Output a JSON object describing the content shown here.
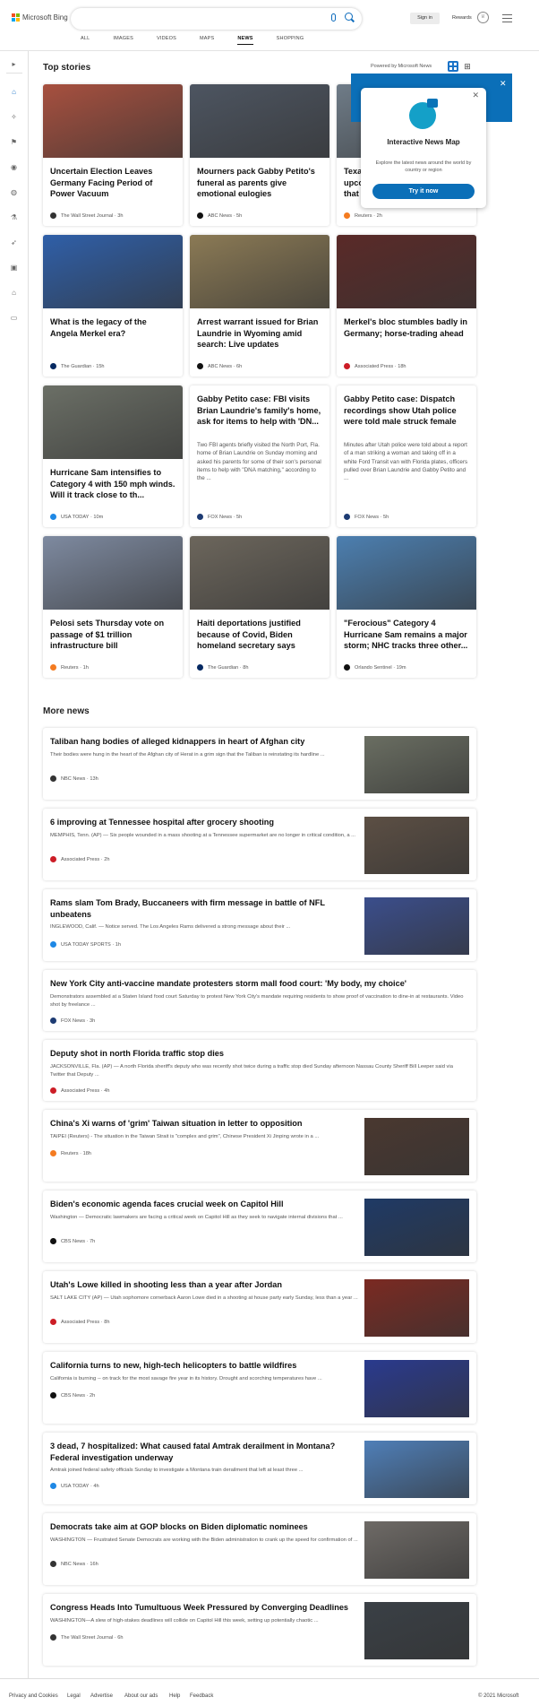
{
  "header": {
    "brand": "Microsoft Bing",
    "search_value": "",
    "signin": "Sign in",
    "rewards": "Rewards",
    "tabs": [
      {
        "label": "ALL"
      },
      {
        "label": "IMAGES"
      },
      {
        "label": "VIDEOS"
      },
      {
        "label": "MAPS"
      },
      {
        "label": "NEWS"
      },
      {
        "label": "SHOPPING"
      }
    ]
  },
  "top_stories": {
    "title": "Top stories",
    "powered": "Powered by Microsoft News"
  },
  "map_popup": {
    "title": "Interactive News Map",
    "desc": "Explore the latest news around the world by country or region",
    "button": "Try it now"
  },
  "cards": [
    {
      "title": "Uncertain Election Leaves Germany Facing Period of Power Vacuum",
      "source": "The Wall Street Journal",
      "time": "3h",
      "logo": "#333333",
      "img": "#a7503f"
    },
    {
      "title": "Mourners pack Gabby Petito's funeral as parents give emotional eulogies",
      "source": "ABC News",
      "time": "5h",
      "logo": "#111111",
      "img": "#4d5561"
    },
    {
      "title": "Texans upcoming that '",
      "source": "Reuters",
      "time": "2h",
      "logo": "#f47b20",
      "img": "#6f7c88"
    },
    {
      "title": "What is the legacy of the Angela Merkel era?",
      "source": "The Guardian",
      "time": "15h",
      "logo": "#052962",
      "img": "#2f5fa8"
    },
    {
      "title": "Arrest warrant issued for Brian Laundrie in Wyoming amid search: Live updates",
      "source": "ABC News",
      "time": "6h",
      "logo": "#111111",
      "img": "#8b7a55"
    },
    {
      "title": "Merkel's bloc stumbles badly in Germany; horse-trading ahead",
      "source": "Associated Press",
      "time": "18h",
      "logo": "#cc1d26",
      "img": "#5a2a28"
    },
    {
      "title": "Hurricane Sam intensifies to Category 4 with 150 mph winds. Will it track close to th...",
      "source": "USA TODAY",
      "time": "10m",
      "logo": "#1e88e5",
      "img": "#6b6f66"
    },
    {
      "title": "Gabby Petito case: FBI visits Brian Laundrie's family's home, ask for items to help with 'DN...",
      "desc": "Two FBI agents briefly visited the North Port, Fla. home of Brian Laundrie on Sunday morning and asked his parents for some of their son's personal items to help with \"DNA matching,\" according to the ...",
      "source": "FOX News",
      "time": "5h",
      "logo": "#1d3b73"
    },
    {
      "title": "Gabby Petito case: Dispatch recordings show Utah police were told male struck female",
      "desc": "Minutes after Utah police were told about a report of a man striking a woman and taking off in a white Ford Transit van with Florida plates, officers pulled over Brian Laundrie and Gabby Petito and ...",
      "source": "FOX News",
      "time": "5h",
      "logo": "#1d3b73"
    },
    {
      "title": "Pelosi sets Thursday vote on passage of $1 trillion infrastructure bill",
      "source": "Reuters",
      "time": "1h",
      "logo": "#f47b20",
      "img": "#7e8aa0"
    },
    {
      "title": "Haiti deportations justified because of Covid, Biden homeland secretary says",
      "source": "The Guardian",
      "time": "8h",
      "logo": "#052962",
      "img": "#6c665c"
    },
    {
      "title": "\"Ferocious\" Category 4 Hurricane Sam remains a major storm; NHC tracks three other...",
      "source": "Orlando Sentinel",
      "time": "19m",
      "logo": "#111111",
      "img": "#4c7fb0"
    }
  ],
  "more_news": {
    "title": "More news",
    "items": [
      {
        "title": "Taliban hang bodies of alleged kidnappers in heart of Afghan city",
        "desc": "Their bodies were hung in the heart of the Afghan city of Herat in a grim sign that the Taliban is reinstating its hardline ...",
        "source": "NBC News",
        "time": "13h",
        "logo": "#333333",
        "img": "#6a6e62"
      },
      {
        "title": "6 improving at Tennessee hospital after grocery shooting",
        "desc": "MEMPHIS, Tenn. (AP) — Six people wounded in a mass shooting at a Tennessee supermarket are no longer in critical condition, a ...",
        "source": "Associated Press",
        "time": "2h",
        "logo": "#cc1d26",
        "img": "#5c4f44"
      },
      {
        "title": "Rams slam Tom Brady, Buccaneers with firm message in battle of NFL unbeatens",
        "desc": "INGLEWOOD, Calif. — Notice served. The Los Angeles Rams delivered a strong message about their ...",
        "source": "USA TODAY SPORTS",
        "time": "1h",
        "logo": "#1e88e5",
        "img": "#3b4e8c"
      },
      {
        "title": "New York City anti-vaccine mandate protesters storm mall food court: 'My body, my choice'",
        "desc": "Demonstrators assembled at a Staten Island food court Saturday to protest New York City's mandate requiring residents to show proof of vaccination to dine-in at restaurants. Video shot by freelance ...",
        "source": "FOX News",
        "time": "3h",
        "logo": "#1d3b73"
      },
      {
        "title": "Deputy shot in north Florida traffic stop dies",
        "desc": "JACKSONVILLE, Fla. (AP) — A north Florida sheriff's deputy who was recently shot twice during a traffic stop died Sunday afternoon Nassau County Sheriff Bill Leeper said via Twitter that Deputy ...",
        "source": "Associated Press",
        "time": "4h",
        "logo": "#cc1d26"
      },
      {
        "title": "China's Xi warns of 'grim' Taiwan situation in letter to opposition",
        "desc": "TAIPEI (Reuters) - The situation in the Taiwan Strait is \"complex and grim\", Chinese President Xi Jinping wrote in a ...",
        "source": "Reuters",
        "time": "18h",
        "logo": "#f47b20",
        "img": "#4a3830"
      },
      {
        "title": "Biden's economic agenda faces crucial week on Capitol Hill",
        "desc": "Washington — Democratic lawmakers are facing a critical week on Capitol Hill as they seek to navigate internal divisions that ...",
        "source": "CBS News",
        "time": "7h",
        "logo": "#111111",
        "img": "#1f3a66"
      },
      {
        "title": "Utah's Lowe killed in shooting less than a year after Jordan",
        "desc": "SALT LAKE CITY (AP) — Utah sophomore cornerback Aaron Lowe died in a shooting at house party early Sunday, less than a year ...",
        "source": "Associated Press",
        "time": "8h",
        "logo": "#cc1d26",
        "img": "#7b2a22"
      },
      {
        "title": "California turns to new, high-tech helicopters to battle wildfires",
        "desc": "California is burning -- on track for the most savage fire year in its history. Drought and scorching temperatures have ...",
        "source": "CBS News",
        "time": "2h",
        "logo": "#111111",
        "img": "#2a3a8e"
      },
      {
        "title": "3 dead, 7 hospitalized: What caused fatal Amtrak derailment in Montana? Federal investigation underway",
        "desc": "Amtrak joined federal safety officials Sunday to investigate a Montana train derailment that left at least three ...",
        "source": "USA TODAY",
        "time": "4h",
        "logo": "#1e88e5",
        "img": "#4f7fb8"
      },
      {
        "title": "Democrats take aim at GOP blocks on Biden diplomatic nominees",
        "desc": "WASHINGTON — Frustrated Senate Democrats are working with the Biden administration to crank up the speed for confirmation of ...",
        "source": "NBC News",
        "time": "16h",
        "logo": "#333333",
        "img": "#6e6a66"
      },
      {
        "title": "Congress Heads Into Tumultuous Week Pressured by Converging Deadlines",
        "desc": "WASHINGTON—A slew of high-stakes deadlines will collide on Capitol Hill this week, setting up potentially chaotic ...",
        "source": "The Wall Street Journal",
        "time": "6h",
        "logo": "#333333",
        "img": "#3a4046"
      }
    ]
  },
  "footer": {
    "links": [
      {
        "label": "Privacy and Cookies"
      },
      {
        "label": "Legal"
      },
      {
        "label": "Advertise"
      },
      {
        "label": "About our ads"
      },
      {
        "label": "Help"
      },
      {
        "label": "Feedback"
      }
    ],
    "copyright": "© 2021 Microsoft"
  }
}
